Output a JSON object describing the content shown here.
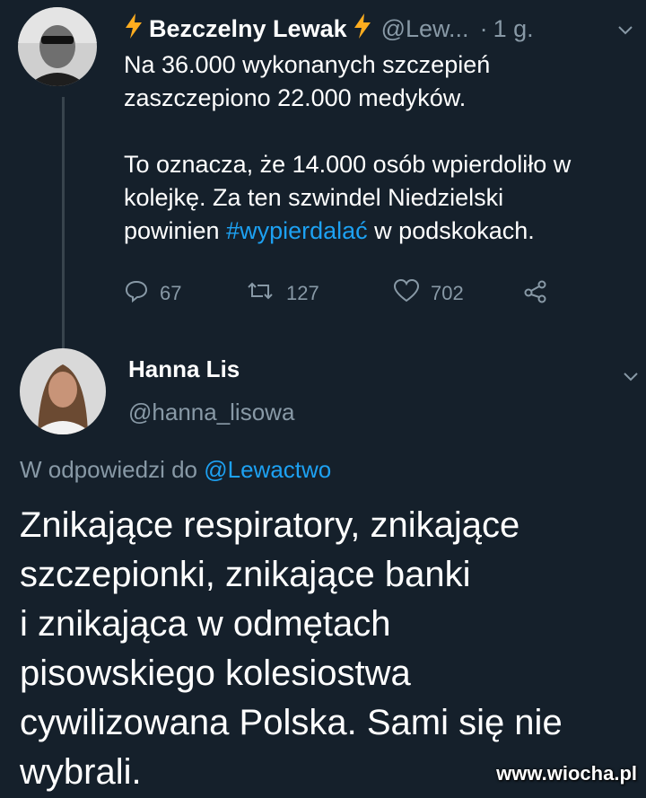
{
  "tweet1": {
    "display_name": "Bezczelny Lewak",
    "handle": "@Lew...",
    "separator": "·",
    "time": "1 g.",
    "text_line1": "Na 36.000 wykonanych szczepień\nzaszczepiono 22.000 medyków.\n\nTo oznacza, że 14.000 osób wpierdoliło w\nkolejkę. Za ten szwindel Niedzielski\npowinien ",
    "hashtag": "#wypierdalać",
    "text_end": " w podskokach.",
    "replies": "67",
    "retweets": "127",
    "likes": "702"
  },
  "tweet2": {
    "display_name": "Hanna Lis",
    "handle": "@hanna_lisowa",
    "reply_prefix": "W odpowiedzi do",
    "reply_handle": "@Lewactwo",
    "text": "Znikające respiratory, znikające\nszczepionki, znikające banki\ni znikająca w odmętach\npisowskiego kolesiostwa\ncywilizowana Polska. Sami się nie\nwybrali."
  },
  "watermark": "www.wiocha.pl",
  "colors": {
    "background": "#15202b",
    "secondary_text": "#8899a6",
    "link": "#1da1f2",
    "bolt": "#ffad1f"
  }
}
